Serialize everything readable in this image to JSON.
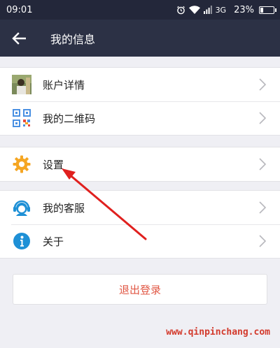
{
  "status_bar": {
    "time": "09:01",
    "network": "3G",
    "battery": "23%",
    "battery_level": 0.23
  },
  "app_bar": {
    "title": "我的信息",
    "back_icon": "arrow-left-icon"
  },
  "groups": [
    {
      "items": [
        {
          "label": "账户详情",
          "icon": "avatar-thumbnail"
        },
        {
          "label": "我的二维码",
          "icon": "qr-code-icon"
        }
      ]
    },
    {
      "items": [
        {
          "label": "设置",
          "icon": "gear-icon"
        }
      ]
    },
    {
      "items": [
        {
          "label": "我的客服",
          "icon": "customer-service-icon"
        },
        {
          "label": "关于",
          "icon": "info-icon"
        }
      ]
    }
  ],
  "logout": {
    "label": "退出登录"
  },
  "watermark": {
    "text": "www.qinpinchang.com"
  },
  "colors": {
    "status_bar": "#23273a",
    "app_bar": "#2c3145",
    "background": "#efeff4",
    "logout_text": "#e15744",
    "annotation_arrow": "#e0201e",
    "gear_icon": "#f5a623",
    "qr_icon": "#4a90e2",
    "info_icon": "#1e90d6"
  }
}
